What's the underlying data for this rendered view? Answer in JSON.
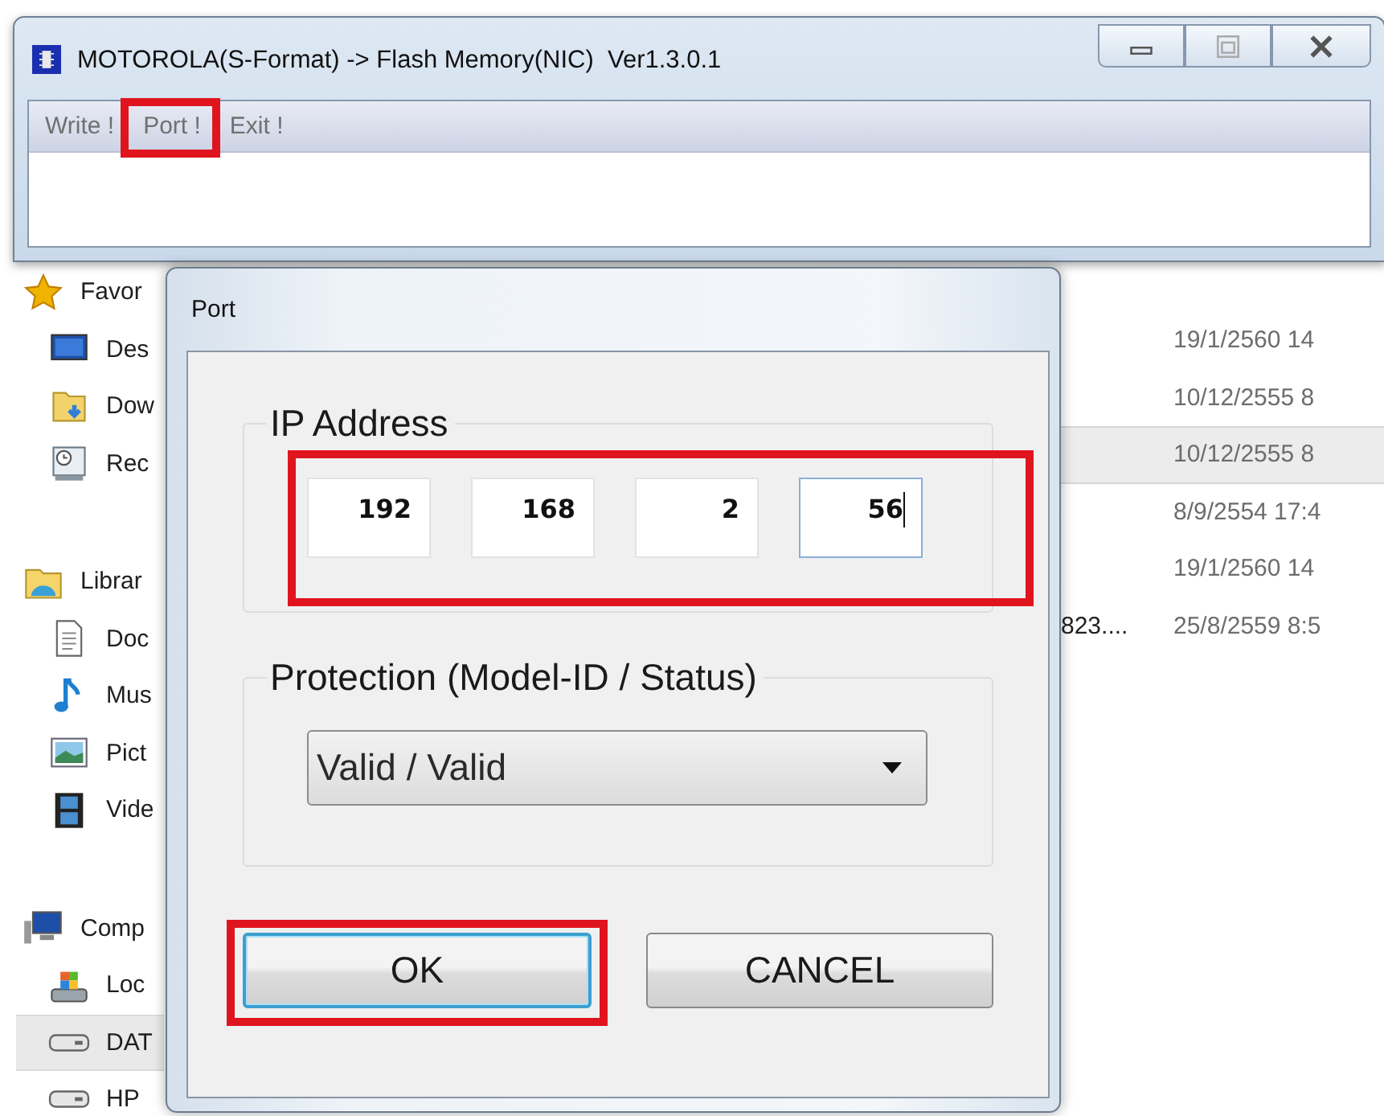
{
  "explorer": {
    "nav": [
      {
        "label": "Favor",
        "kind": "star",
        "selected": false,
        "children": [
          {
            "label": "Des",
            "kind": "desktop",
            "selected": false
          },
          {
            "label": "Dow",
            "kind": "download",
            "selected": false
          },
          {
            "label": "Rec",
            "kind": "recent",
            "selected": false
          }
        ]
      },
      {
        "label": "Librar",
        "kind": "library",
        "selected": false,
        "children": [
          {
            "label": "Doc",
            "kind": "document",
            "selected": false
          },
          {
            "label": "Mus",
            "kind": "music",
            "selected": false
          },
          {
            "label": "Pict",
            "kind": "pictures",
            "selected": false
          },
          {
            "label": "Vide",
            "kind": "video",
            "selected": false
          }
        ]
      },
      {
        "label": "Comp",
        "kind": "computer",
        "selected": false,
        "children": [
          {
            "label": "Loc",
            "kind": "system-drive",
            "selected": false
          },
          {
            "label": "DAT",
            "kind": "drive",
            "selected": true
          },
          {
            "label": "HP",
            "kind": "drive",
            "selected": false
          }
        ]
      }
    ],
    "rows": [
      {
        "date": "19/1/2560 14",
        "selected": false
      },
      {
        "date": "10/12/2555 8",
        "selected": false
      },
      {
        "date": "10/12/2555 8",
        "selected": true
      },
      {
        "date": "8/9/2554 17:4",
        "selected": false
      },
      {
        "date": "19/1/2560 14",
        "selected": false
      },
      {
        "name": "823....",
        "date": "25/8/2559 8:5",
        "selected": false
      }
    ]
  },
  "window": {
    "title": "MOTOROLA(S-Format) -> Flash Memory(NIC)  Ver1.3.0.1",
    "menu": [
      {
        "label": "Write !",
        "highlighted": false
      },
      {
        "label": "Port !",
        "highlighted": true
      },
      {
        "label": "Exit !",
        "highlighted": false
      }
    ]
  },
  "dialog": {
    "title": "Port",
    "ip_group": {
      "label": "IP Address",
      "highlighted": true,
      "octets": [
        {
          "value": "192",
          "focused": false
        },
        {
          "value": "168",
          "focused": false
        },
        {
          "value": "2",
          "focused": false
        },
        {
          "value": "56",
          "focused": true
        }
      ]
    },
    "protection_group": {
      "label": "Protection (Model-ID / Status)",
      "value": "Valid / Valid"
    },
    "buttons": [
      {
        "label": "OK",
        "default": true,
        "highlighted": true
      },
      {
        "label": "CANCEL",
        "default": false,
        "highlighted": false
      }
    ]
  }
}
